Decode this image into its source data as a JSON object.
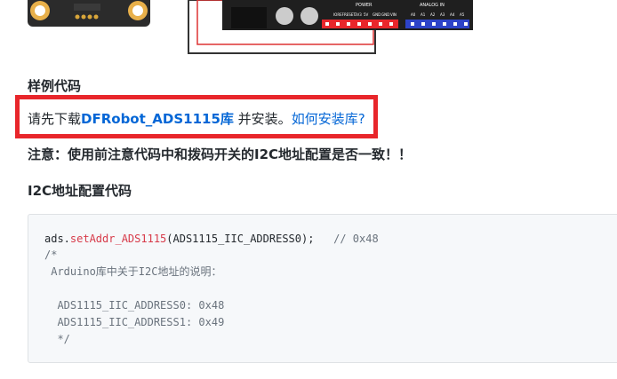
{
  "images": {
    "board_alt": "",
    "wiring_alt": "",
    "wiring_labels": {
      "power": "POWER",
      "analog_in": "ANALOG IN",
      "power_pins": [
        "IOREF",
        "RESET",
        "3V3",
        "5V",
        "GND",
        "GND",
        "VIN"
      ],
      "analog_pins": [
        "A0",
        "A1",
        "A2",
        "A3",
        "A4",
        "A5"
      ]
    }
  },
  "sections": {
    "sample_title": "样例代码",
    "install_prefix": "请先下载",
    "library_link": "DFRobot_ADS1115库",
    "install_middle": " 并安装。",
    "howto_link": "如何安装库?",
    "note": "注意：使用前注意代码中和拨码开关的I2C地址配置是否一致！！",
    "i2c_title": "I2C地址配置代码"
  },
  "code": {
    "line1_obj": "ads.",
    "line1_func": "setAddr_ADS1115",
    "line1_args": "(ADS1115_IIC_ADDRESS0);   ",
    "line1_comment": "// 0x48",
    "line2": "/*",
    "line3": " Arduino库中关于I2C地址的说明：",
    "line4": "  ADS1115_IIC_ADDRESS0: 0x48",
    "line5": "  ADS1115_IIC_ADDRESS1: 0x49",
    "line6": "  */"
  },
  "colors": {
    "link": "#0366d6",
    "highlight_border": "#e8262b",
    "code_bg": "#f6f8fa",
    "code_func": "#d73a49",
    "code_comment": "#6a737d"
  }
}
